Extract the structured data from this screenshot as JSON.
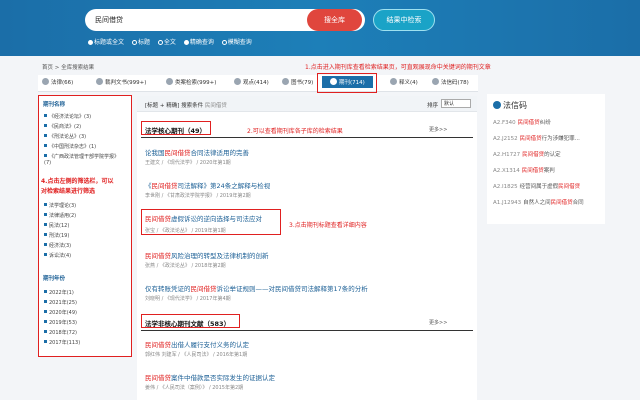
{
  "header": {
    "search_value": "民间借贷",
    "search_button": "搜全库",
    "research_button": "结果中检索",
    "options": [
      "标题或全文",
      "标题",
      "全文",
      "精确查询",
      "模糊查询"
    ]
  },
  "breadcrumb": "首页 > 全库搜索结果",
  "annotations": {
    "a1": "1.点击进入期刊库查看检索结果页，可直观展现命中关键词的期刊文章",
    "a2": "2.可以查看期刊库各子库的检索结果",
    "a3": "3.点击期刊标题查看详细内容",
    "a4_1": "4.点击左侧的筛选栏，可以",
    "a4_2": "对检索结果进行筛选"
  },
  "tabs": [
    {
      "label": "法律(66)"
    },
    {
      "label": "裁判文书(999+)"
    },
    {
      "label": "类案检索(999+)"
    },
    {
      "label": "观点(414)"
    },
    {
      "label": "图书(79)"
    },
    {
      "label": "期刊(714)"
    },
    {
      "label": "释义(4)"
    },
    {
      "label": "法信码(78)"
    }
  ],
  "sidebar": {
    "g1_title": "期刊名称",
    "g1_items": [
      "《经济法论坛》(3)",
      "《民商法》(2)",
      "《刑法论丛》(3)",
      "《中国刑法杂志》(1)",
      "《广西政法管理干部学院学报》(7)"
    ],
    "g2_items": [
      "法学理论(3)",
      "法律适用(2)",
      "民法(12)",
      "刑法(19)",
      "经济法(3)",
      "诉讼法(4)"
    ],
    "g3_title": "期刊年份",
    "g3_items": [
      "2022年(1)",
      "2021年(25)",
      "2020年(49)",
      "2019年(53)",
      "2018年(72)",
      "2017年(113)"
    ]
  },
  "main": {
    "bar_label": "[标题 + 精确] 搜索条件",
    "bar_keyword": "民间借贷",
    "sort_label": "排序",
    "sort_value": "默认",
    "sec1_title": "法学核心期刊（49）",
    "sec2_title": "法学非核心期刊文献（583）",
    "more": "更多>>",
    "core": [
      {
        "pre": "论我国",
        "hl": "民间借贷",
        "post": "合同法律适用的完善",
        "meta": "王建文 / 《现代法学》 / 2020年第1期"
      },
      {
        "pre": "《",
        "hl": "民间借贷",
        "post": "司法解释》第24条之解释与检视",
        "meta": "李世刚 / 《甘肃政法学院学报》 / 2019年第2期"
      },
      {
        "pre": "",
        "hl": "民间借贷",
        "post": "虚假诉讼的逆向选择与司法应对",
        "meta": "张宝 / 《政法论丛》 / 2019年第1期"
      },
      {
        "pre": "",
        "hl": "民间借贷",
        "post": "风险治理的转型及法律机制的创新",
        "meta": "张燕 / 《政法论丛》 / 2018年第2期"
      },
      {
        "pre": "仅有转账凭证的",
        "hl": "民间借贷",
        "post": "诉讼举证规则——对民间借贷司法解释第17条的分析",
        "meta": "刘晓明 / 《现代法学》 / 2017年第4期"
      }
    ],
    "noncore": [
      {
        "pre": "",
        "hl": "民间借贷",
        "post": "出借人履行支付义务的认定",
        "meta": "郭红伟 刘建军 / 《人民司法》 / 2016年第1期"
      },
      {
        "pre": "",
        "hl": "民间借贷",
        "post": "案件中借款是否实际发生的证据认定",
        "meta": "姜伟 / 《人民司法（案例）》 / 2015年第2期"
      }
    ]
  },
  "right": {
    "title": "法信码",
    "items": [
      {
        "code": "A2.F340",
        "pre": "",
        "hl": "民间借贷",
        "post": "纠纷"
      },
      {
        "code": "A2.J2152",
        "pre": "",
        "hl": "民间借贷",
        "post": "行为涉嫌犯罪..."
      },
      {
        "code": "A2.H1727",
        "pre": "",
        "hl": "民间借贷",
        "post": "的认定"
      },
      {
        "code": "A2.X1314",
        "pre": "",
        "hl": "民间借贷",
        "post": "案判"
      },
      {
        "code": "A2.I1825",
        "pre": "经营间属于虚假",
        "hl": "民间借贷",
        "post": ""
      },
      {
        "code": "A1.J12943",
        "pre": "自然人之间",
        "hl": "民间借贷",
        "post": "合同"
      }
    ]
  }
}
